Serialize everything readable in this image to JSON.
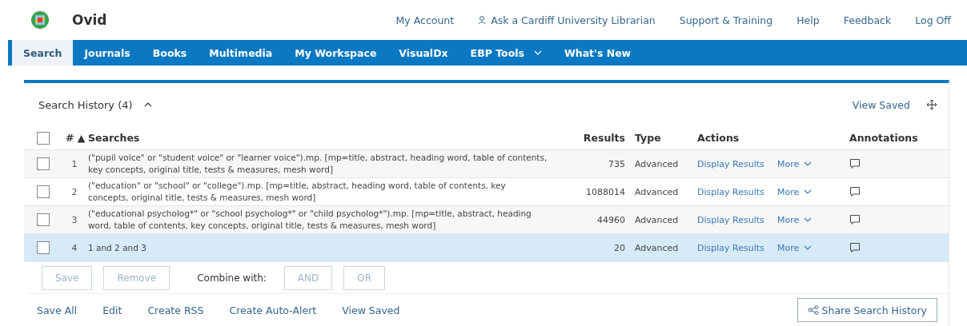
{
  "brand": {
    "name": "Ovid"
  },
  "top_links": [
    {
      "label": "My Account",
      "kind": "plain"
    },
    {
      "label": "Ask a Cardiff University Librarian",
      "kind": "librarian"
    },
    {
      "label": "Support & Training",
      "kind": "plain"
    },
    {
      "label": "Help",
      "kind": "plain"
    },
    {
      "label": "Feedback",
      "kind": "plain"
    },
    {
      "label": "Log Off",
      "kind": "plain"
    }
  ],
  "nav_tabs": [
    {
      "label": "Search",
      "selected": true,
      "dropdown": false
    },
    {
      "label": "Journals",
      "selected": false,
      "dropdown": false
    },
    {
      "label": "Books",
      "selected": false,
      "dropdown": false
    },
    {
      "label": "Multimedia",
      "selected": false,
      "dropdown": false
    },
    {
      "label": "My Workspace",
      "selected": false,
      "dropdown": false
    },
    {
      "label": "VisualDx",
      "selected": false,
      "dropdown": false
    },
    {
      "label": "EBP Tools",
      "selected": false,
      "dropdown": true
    },
    {
      "label": "What's New",
      "selected": false,
      "dropdown": false
    }
  ],
  "panel": {
    "title": "Search History (4)",
    "expanded": true,
    "view_saved": "View Saved"
  },
  "table": {
    "columns": [
      "#",
      "Searches",
      "Results",
      "Type",
      "Actions",
      "Annotations"
    ],
    "all_checked": false,
    "sort_indicator": "▲",
    "rows": [
      {
        "number": "1",
        "search": "(\"pupil voice\" or \"student voice\" or \"learner voice\").mp. [mp=title, abstract, heading word, table of contents, key concepts, original title, tests & measures, mesh word]",
        "results": "735",
        "type": "Advanced",
        "display": "Display Results",
        "more": "More",
        "checked": false,
        "selected": false
      },
      {
        "number": "2",
        "search": "(\"education\" or \"school\" or \"college\").mp. [mp=title, abstract, heading word, table of contents, key concepts, original title, tests & measures, mesh word]",
        "results": "1088014",
        "type": "Advanced",
        "display": "Display Results",
        "more": "More",
        "checked": false,
        "selected": false
      },
      {
        "number": "3",
        "search": "(\"educational psycholog*\" or \"school psycholog*\" or \"child psycholog*\").mp. [mp=title, abstract, heading word, table of contents, key concepts, original title, tests & measures, mesh word]",
        "results": "44960",
        "type": "Advanced",
        "display": "Display Results",
        "more": "More",
        "checked": false,
        "selected": false
      },
      {
        "number": "4",
        "search": "1 and 2 and 3",
        "results": "20",
        "type": "Advanced",
        "display": "Display Results",
        "more": "More",
        "checked": false,
        "selected": true
      }
    ]
  },
  "row_actions": {
    "buttons": [
      {
        "label": "Save",
        "disabled": true
      },
      {
        "label": "Remove",
        "disabled": true
      }
    ],
    "combine_label": "Combine with:",
    "combine_buttons": [
      {
        "label": "AND",
        "disabled": true
      },
      {
        "label": "OR",
        "disabled": true
      }
    ]
  },
  "footer_links": [
    "Save All",
    "Edit",
    "Create RSS",
    "Create Auto-Alert",
    "View Saved"
  ],
  "share_button": "Share Search History"
}
